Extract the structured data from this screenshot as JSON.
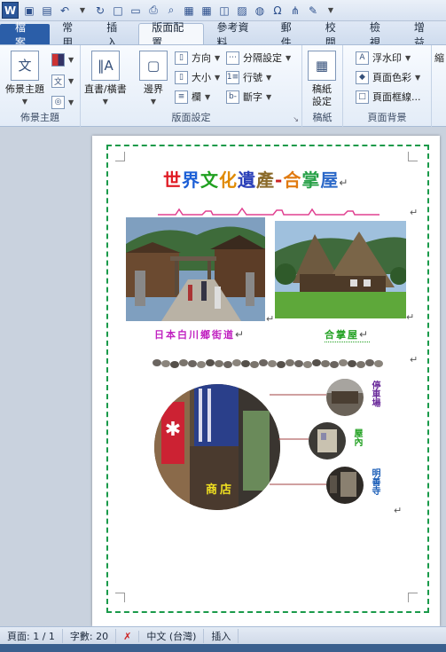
{
  "tabs": [
    "檔案",
    "常用",
    "插入",
    "版面配置",
    "參考資料",
    "郵件",
    "校閱",
    "檢視",
    "增益"
  ],
  "ribbon": {
    "group_theme": {
      "label": "佈景主題",
      "button": "佈景主題"
    },
    "group_page_setup": {
      "label": "版面設定",
      "text_direction": "直書/橫書",
      "margins": "邊界",
      "orientation": "方向",
      "size": "大小",
      "columns": "欄",
      "breaks": "分隔設定",
      "line_numbers": "行號",
      "hyphenation": "斷字"
    },
    "group_manuscript": {
      "label": "稿紙",
      "button": "稿紙\n設定"
    },
    "group_page_bg": {
      "label": "頁面背景",
      "watermark": "浮水印",
      "page_color": "頁面色彩",
      "page_borders": "頁面框線..."
    },
    "group_arrange_partial": "縮"
  },
  "document": {
    "title_chars": [
      "世",
      "界",
      "文",
      "化",
      "遺",
      "產",
      "-",
      "合",
      "掌",
      "屋"
    ],
    "title_colors": [
      "#e01b24",
      "#1d5fd6",
      "#20a020",
      "#e08a00",
      "#2a3fb8",
      "#8a6a2a",
      "#cc2222",
      "#e07a10",
      "#26a046",
      "#2b68c8"
    ],
    "caption1": "日本白川鄉街道",
    "caption2": "合掌屋",
    "label_parking": "停車場",
    "label_house": "屋內",
    "label_temple": "明善寺",
    "label_shop": "商店",
    "paragraph_mark": "↵"
  },
  "status": {
    "page": "頁面: 1 / 1",
    "words": "字數: 20",
    "lang": "中文 (台灣)",
    "mode": "插入"
  },
  "colors": {
    "border": "#1a9a4a",
    "ribbon_file": "#2b5ea8",
    "caption1": "#c020c0",
    "caption2": "#20a020"
  }
}
